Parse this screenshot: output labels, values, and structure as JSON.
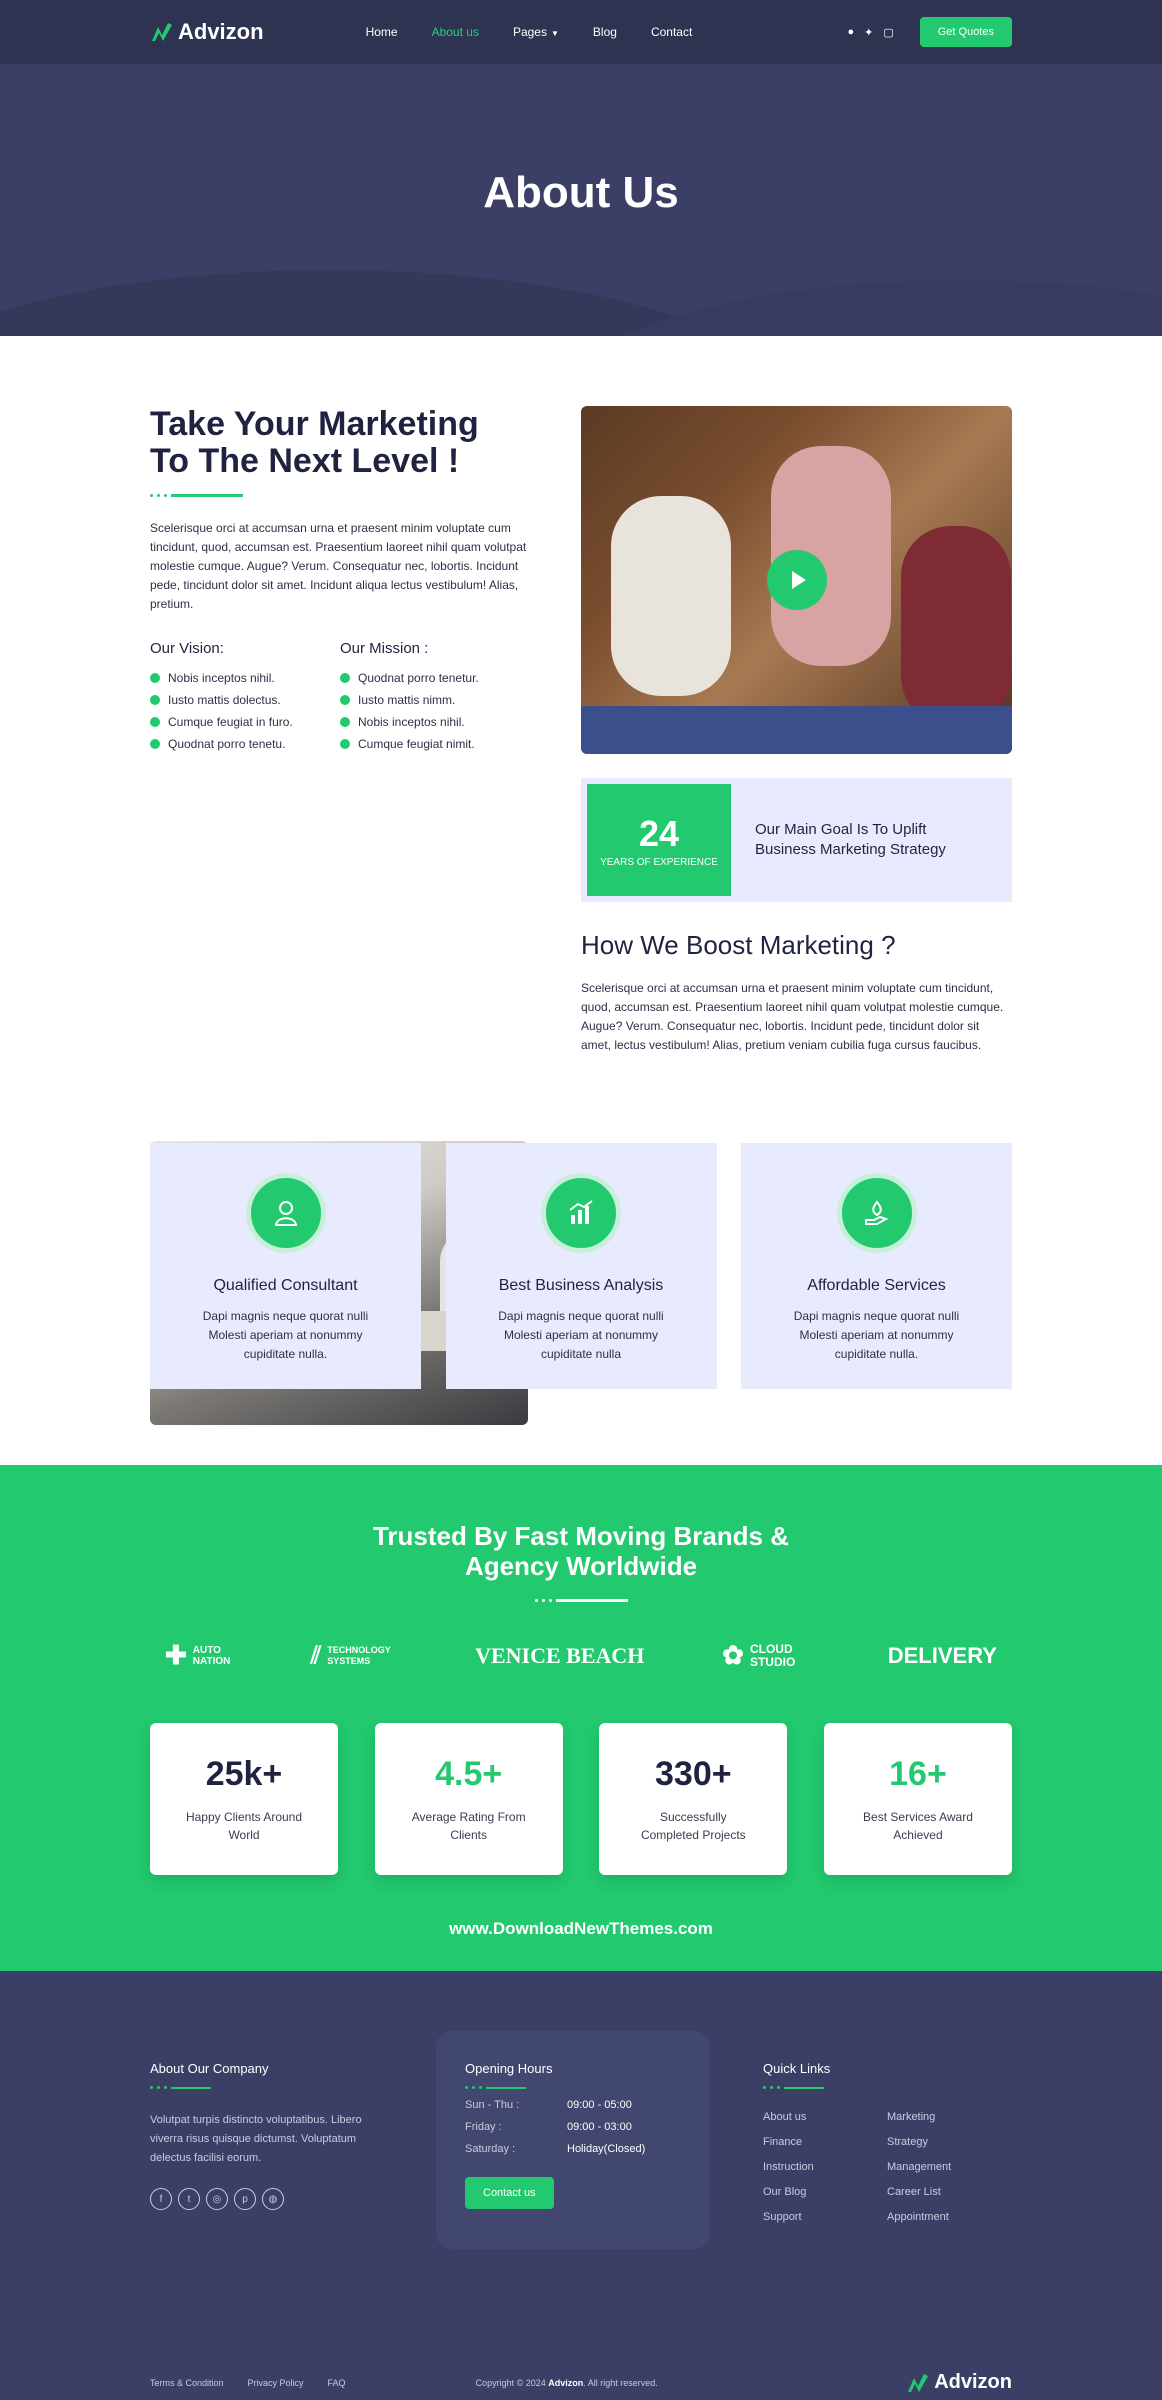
{
  "header": {
    "logo_text": "Advizon",
    "nav": [
      {
        "label": "Home"
      },
      {
        "label": "About us",
        "active": true
      },
      {
        "label": "Pages"
      },
      {
        "label": "Blog"
      },
      {
        "label": "Contact"
      }
    ],
    "social_icons": [
      "facebook-icon",
      "twitter-icon",
      "instagram-icon"
    ],
    "cta_label": "Get Quotes",
    "page_title": "About Us"
  },
  "about": {
    "title_line1": "Take Your Marketing",
    "title_line2": "To The Next Level !",
    "paragraph": "Scelerisque orci at accumsan urna et praesent minim voluptate cum tincidunt, quod, accumsan est. Praesentium laoreet nihil quam volutpat molestie cumque. Augue? Verum. Consequatur nec, lobortis. Incidunt pede, tincidunt dolor sit amet. Incidunt aliqua lectus vestibulum! Alias, pretium.",
    "vision": {
      "title": "Our Vision:",
      "items": [
        "Nobis inceptos nihil.",
        "Iusto mattis dolectus.",
        "Cumque feugiat in furo.",
        "Quodnat porro tenetu."
      ]
    },
    "mission": {
      "title": "Our Mission :",
      "items": [
        "Quodnat porro tenetur.",
        "Iusto mattis nimm.",
        "Nobis inceptos nihil.",
        "Cumque feugiat nimit."
      ]
    },
    "years": {
      "number": "24",
      "label": "Years Of Experience"
    },
    "goal_text": "Our Main Goal Is To Uplift Business Marketing Strategy",
    "boost_title": "How We Boost Marketing ?",
    "boost_paragraph": "Scelerisque orci at accumsan urna et praesent minim voluptate cum tincidunt, quod, accumsan est. Praesentium laoreet nihil quam volutpat molestie cumque. Augue? Verum. Consequatur nec, lobortis. Incidunt pede, tincidunt dolor sit amet, lectus vestibulum! Alias, pretium veniam cubilia fuga cursus faucibus."
  },
  "features": [
    {
      "title": "Qualified Consultant",
      "text": "Dapi magnis neque quorat nulli Molesti aperiam at nonummy cupiditate nulla.",
      "icon": "consultant-icon"
    },
    {
      "title": "Best Business Analysis",
      "text": "Dapi magnis neque quorat nulli Molesti aperiam at nonummy cupiditate nulla",
      "icon": "analysis-icon"
    },
    {
      "title": "Affordable Services",
      "text": "Dapi magnis neque quorat nulli Molesti aperiam at nonummy cupiditate nulla.",
      "icon": "services-icon"
    }
  ],
  "trusted": {
    "title_line1": "Trusted By Fast Moving Brands &",
    "title_line2": "Agency Worldwide",
    "brands": [
      {
        "name": "AUTO NATION",
        "icon": "puzzle-icon"
      },
      {
        "name": "TECHNOLOGY SYSTEMS",
        "icon": "stripes-icon"
      },
      {
        "name": "VENICE BEACH",
        "icon": "beach-icon"
      },
      {
        "name": "CLOUD STUDIO",
        "icon": "flower-icon"
      },
      {
        "name": "DELIVERY",
        "icon": "delivery-icon"
      }
    ],
    "stats": [
      {
        "value": "25k+",
        "label": "Happy Clients Around World",
        "color": "#1f2340"
      },
      {
        "value": "4.5+",
        "label": "Average Rating From Clients",
        "color": "#22c96e"
      },
      {
        "value": "330+",
        "label": "Successfully Completed Projects",
        "color": "#1f2340"
      },
      {
        "value": "16+",
        "label": "Best Services Award Achieved",
        "color": "#22c96e"
      }
    ],
    "watermark": "www.DownloadNewThemes.com"
  },
  "footer": {
    "about_title": "About Our Company",
    "about_text": "Volutpat turpis distincto voluptatibus. Libero viverra risus quisque dictumst. Voluptatum delectus facilisi eorum.",
    "socials": [
      "facebook-icon",
      "twitter-icon",
      "instagram-icon",
      "pinterest-icon",
      "dribbble-icon"
    ],
    "hours_title": "Opening Hours",
    "hours": [
      {
        "day": "Sun - Thu :",
        "time": "09:00 - 05:00"
      },
      {
        "day": "Friday :",
        "time": "09:00 - 03:00"
      },
      {
        "day": "Saturday :",
        "time": "Holiday(Closed)"
      }
    ],
    "contact_label": "Contact us",
    "links_title": "Quick Links",
    "links": [
      "About us",
      "Marketing",
      "Finance",
      "Strategy",
      "Instruction",
      "Management",
      "Our Blog",
      "Career List",
      "Support",
      "Appointment"
    ],
    "bottom_links": [
      "Terms & Condition",
      "Privacy Policy",
      "FAQ"
    ],
    "copyright_prefix": "Copyright © 2024",
    "copyright_brand": "Advizon",
    "copyright_suffix": ". All right reserved.",
    "logo_text": "Advizon"
  },
  "colors": {
    "accent": "#22c96e",
    "dark": "#3b3f66",
    "light": "#e8ebfd"
  }
}
